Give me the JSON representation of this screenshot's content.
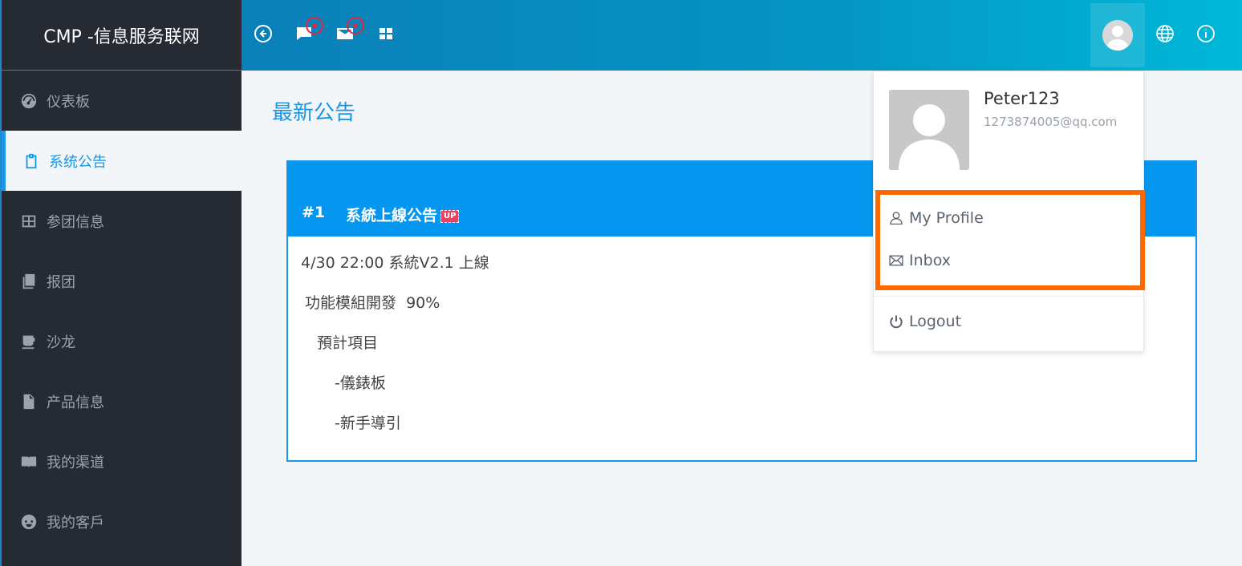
{
  "brand": "CMP -信息服务联网",
  "sidebar": {
    "items": [
      {
        "label": "仪表板",
        "icon": "dashboard-icon"
      },
      {
        "label": "系统公告",
        "icon": "clipboard-icon",
        "active": true
      },
      {
        "label": "参团信息",
        "icon": "grid-icon"
      },
      {
        "label": "报团",
        "icon": "books-icon"
      },
      {
        "label": "沙龙",
        "icon": "coffee-icon"
      },
      {
        "label": "产品信息",
        "icon": "file-icon"
      },
      {
        "label": "我的渠道",
        "icon": "book-open-icon"
      },
      {
        "label": "我的客戶",
        "icon": "face-icon"
      }
    ]
  },
  "header": {
    "icons": [
      "back-icon",
      "chat-icon",
      "mail-icon",
      "apps-icon",
      "globe-icon",
      "info-icon"
    ]
  },
  "main": {
    "title": "最新公告",
    "announcement": {
      "number": "#1",
      "title": "系統上線公告",
      "badge": "UP",
      "lines": [
        "4/30 22:00 系統V2.1 上線",
        "功能模組開發  90%",
        "預計項目",
        "-儀錶板",
        "-新手導引"
      ]
    }
  },
  "dropdown": {
    "username": "Peter123",
    "email": "1273874005@qq.com",
    "items": {
      "profile": "My Profile",
      "inbox": "Inbox",
      "logout": "Logout"
    }
  },
  "colors": {
    "accent": "#1a96e6",
    "sidebar_bg": "#262a33",
    "highlight": "#ff6a00"
  }
}
